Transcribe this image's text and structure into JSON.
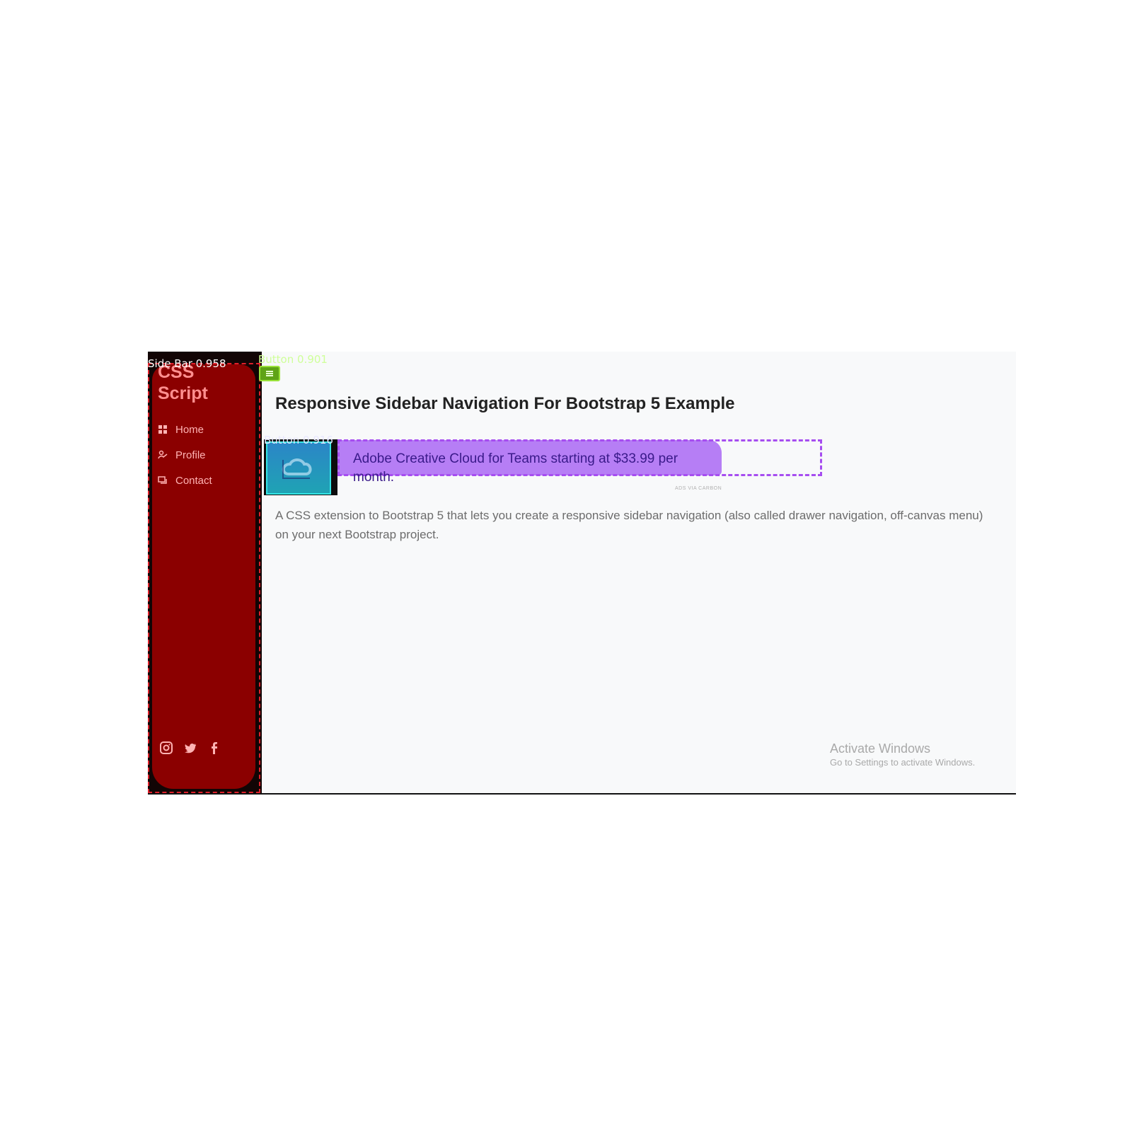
{
  "sidebar": {
    "brand": "CSS Script",
    "items": [
      {
        "label": "Home",
        "icon": "grid-icon"
      },
      {
        "label": "Profile",
        "icon": "person-icon"
      },
      {
        "label": "Contact",
        "icon": "chat-icon"
      }
    ],
    "socials": [
      {
        "icon": "instagram-icon"
      },
      {
        "icon": "twitter-icon"
      },
      {
        "icon": "facebook-icon"
      }
    ]
  },
  "detections": {
    "sidebar_label": "Side Bar 0.958",
    "button_label": "Button 0.901",
    "ad_label": "Button 0.916"
  },
  "main": {
    "title": "Responsive Sidebar Navigation For Bootstrap 5 Example",
    "ad": {
      "text": "Adobe Creative Cloud for Teams starting at $33.99 per month.",
      "via": "ADS VIA CARBON"
    },
    "description": "A CSS extension to Bootstrap 5 that lets you create a responsive sidebar navigation (also called drawer navigation, off-canvas menu) on your next Bootstrap project."
  },
  "watermark": {
    "title": "Activate Windows",
    "subtitle": "Go to Settings to activate Windows."
  },
  "colors": {
    "sidebar": "#8b0000",
    "sidebar_text": "#ff8f8f",
    "toggle": "#5fa317",
    "ad_highlight": "#b67ef5",
    "ad_image": "#1fa3b4",
    "background": "#f8f9fa"
  }
}
